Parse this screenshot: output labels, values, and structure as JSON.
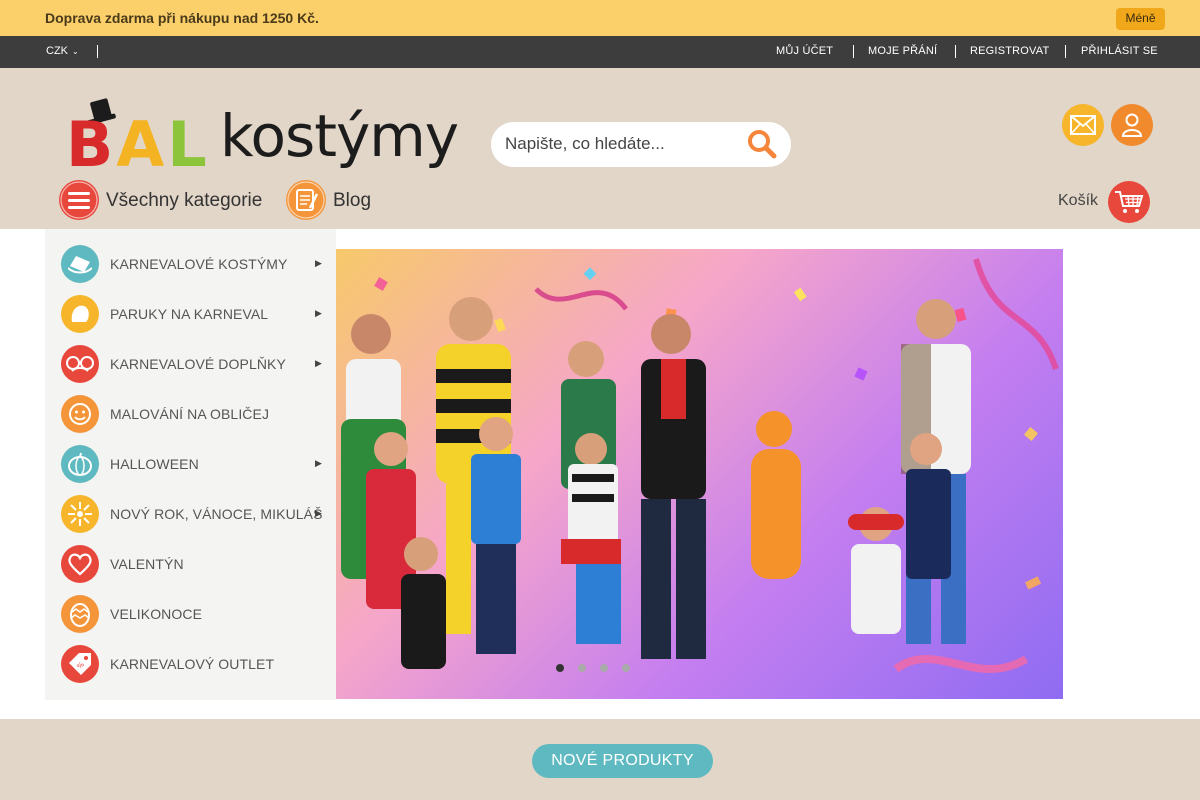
{
  "promo": {
    "text": "Doprava zdarma při nákupu nad 1250 Kč.",
    "button": "Méně"
  },
  "topbar": {
    "currency": "CZK",
    "links": [
      "MŮJ ÚČET",
      "MOJE PŘÁNÍ",
      "REGISTROVAT",
      "PŘIHLÁSIT SE"
    ]
  },
  "logo": {
    "part1": "BAL",
    "part2": "kostýmy"
  },
  "search": {
    "placeholder": "Napište, co hledáte..."
  },
  "nav": {
    "categories": "Všechny kategorie",
    "blog": "Blog",
    "cart": "Košík"
  },
  "categories": [
    {
      "label": "KARNEVALOVÉ KOSTÝMY",
      "icon": "hat-icon",
      "color": "#5fb9c1",
      "has_sub": true
    },
    {
      "label": "PARUKY NA KARNEVAL",
      "icon": "wig-icon",
      "color": "#f7b52b",
      "has_sub": true
    },
    {
      "label": "KARNEVALOVÉ DOPLŇKY",
      "icon": "glasses-icon",
      "color": "#e8473c",
      "has_sub": true
    },
    {
      "label": "MALOVÁNÍ NA OBLIČEJ",
      "icon": "face-paint-icon",
      "color": "#f5953a",
      "has_sub": false
    },
    {
      "label": "HALLOWEEN",
      "icon": "pumpkin-icon",
      "color": "#5fb9c1",
      "has_sub": true
    },
    {
      "label": "NOVÝ ROK, VÁNOCE, MIKULÁŠ",
      "icon": "firework-icon",
      "color": "#f7b52b",
      "has_sub": true
    },
    {
      "label": "VALENTÝN",
      "icon": "heart-icon",
      "color": "#e8473c",
      "has_sub": false
    },
    {
      "label": "VELIKONOCE",
      "icon": "easter-egg-icon",
      "color": "#f5953a",
      "has_sub": false
    },
    {
      "label": "KARNEVALOVÝ OUTLET",
      "icon": "price-tag-icon",
      "color": "#e8473c",
      "has_sub": false
    }
  ],
  "slider": {
    "slides": 4,
    "active": 1
  },
  "section": {
    "new_products": "NOVÉ PRODUKTY"
  }
}
